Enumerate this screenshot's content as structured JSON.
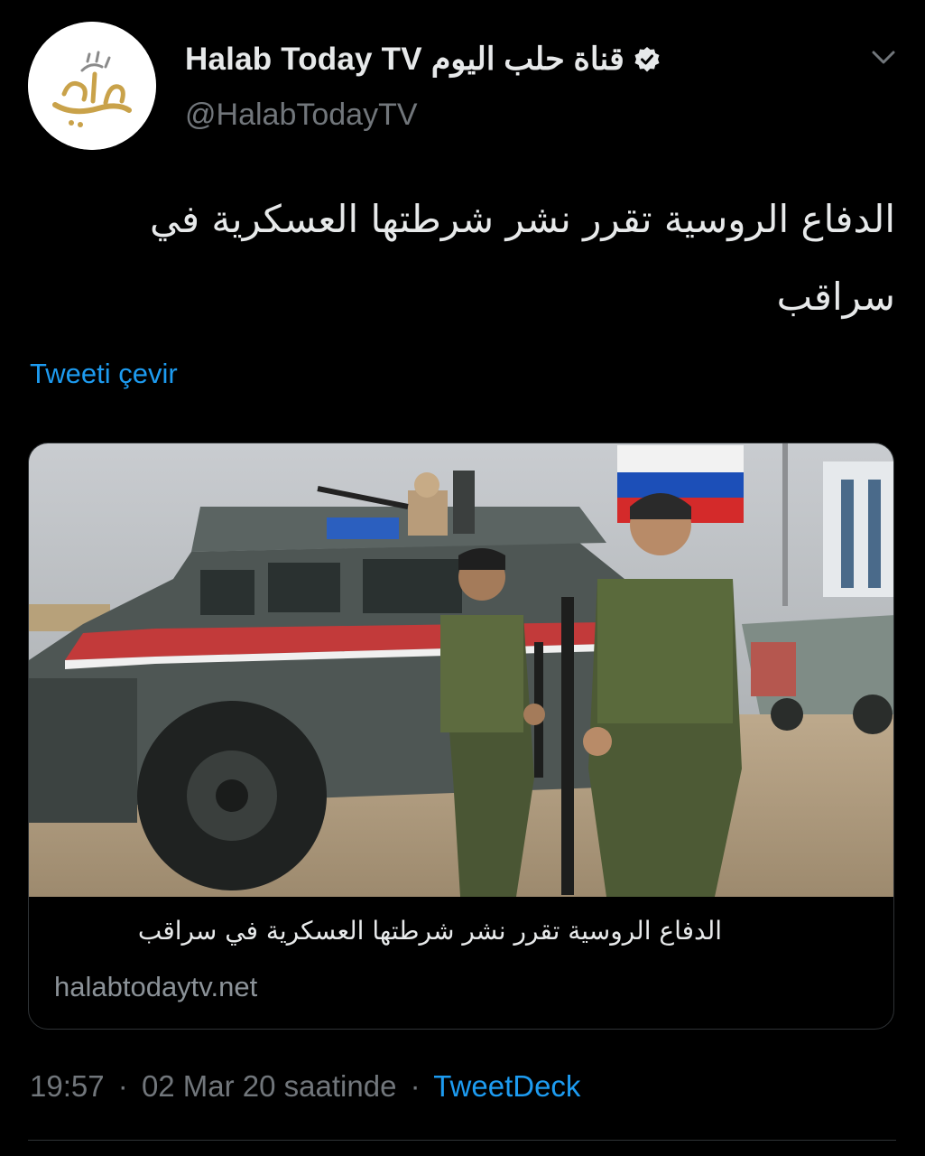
{
  "author": {
    "display_name_latin": "Halab Today TV",
    "display_name_arabic": "قناة حلب اليوم",
    "handle": "@HalabTodayTV",
    "verified": true,
    "avatar_logo_text": "حلب اليوم"
  },
  "tweet": {
    "text": "الدفاع الروسية تقرر نشر شرطتها العسكرية في سراقب",
    "translate_label": "Tweeti çevir"
  },
  "card": {
    "title": "الدفاع الروسية تقرر نشر شرطتها العسكرية في سراقب",
    "domain": "halabtodaytv.net"
  },
  "meta": {
    "time": "19:57",
    "date": "02 Mar 20 saatinde",
    "separator": "·",
    "source": "TweetDeck"
  },
  "colors": {
    "background": "#000000",
    "text_primary": "#e7e9ea",
    "text_secondary": "#71767b",
    "link": "#1d9bf0",
    "border": "#2f3336",
    "logo_gold": "#c9a24a"
  },
  "icons": {
    "verified": "verified-badge-icon",
    "more": "chevron-down-icon"
  }
}
